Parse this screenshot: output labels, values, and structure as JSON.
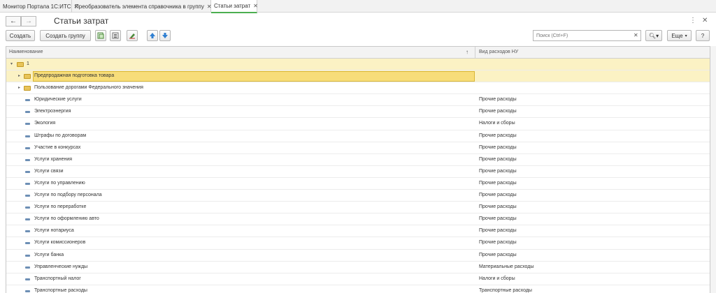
{
  "tabs": [
    {
      "label": "Монитор Портала 1С:ИТС"
    },
    {
      "label": "Преобразователь элемента справочника в группу"
    },
    {
      "label": "Статьи затрат"
    }
  ],
  "header": {
    "title": "Статьи затрат"
  },
  "toolbar": {
    "create": "Создать",
    "create_group": "Создать группу",
    "search_placeholder": "Поиск (Ctrl+F)",
    "more": "Еще"
  },
  "grid": {
    "col_name": "Наименование",
    "col_type": "Вид расходов НУ",
    "rows": [
      {
        "name": "1",
        "type": ""
      },
      {
        "name": "Предпродажная подготовка товара",
        "type": ""
      },
      {
        "name": "Пользование дорогами Федерального значения",
        "type": ""
      },
      {
        "name": "Юридические услуги",
        "type": "Прочие расходы"
      },
      {
        "name": "Электроэнергия",
        "type": "Прочие расходы"
      },
      {
        "name": "Экология",
        "type": "Налоги и сборы"
      },
      {
        "name": "Штрафы по договорам",
        "type": "Прочие расходы"
      },
      {
        "name": "Участие в конкурсах",
        "type": "Прочие расходы"
      },
      {
        "name": "Услуги хранения",
        "type": "Прочие расходы"
      },
      {
        "name": "Услуги связи",
        "type": "Прочие расходы"
      },
      {
        "name": "Услуги по управлению",
        "type": "Прочие расходы"
      },
      {
        "name": "Услуги по подбору персонала",
        "type": "Прочие расходы"
      },
      {
        "name": "Услуги по переработке",
        "type": "Прочие расходы"
      },
      {
        "name": "Услуги по оформлению авто",
        "type": "Прочие расходы"
      },
      {
        "name": "Услуги нотариуса",
        "type": "Прочие расходы"
      },
      {
        "name": "Услуги комиссионеров",
        "type": "Прочие расходы"
      },
      {
        "name": "Услуги банка",
        "type": "Прочие расходы"
      },
      {
        "name": "Управленческие нужды",
        "type": "Материальные расходы"
      },
      {
        "name": "Транспортный налог",
        "type": "Налоги и сборы"
      },
      {
        "name": "Транспортные расходы",
        "type": "Транспортные расходы"
      }
    ]
  }
}
